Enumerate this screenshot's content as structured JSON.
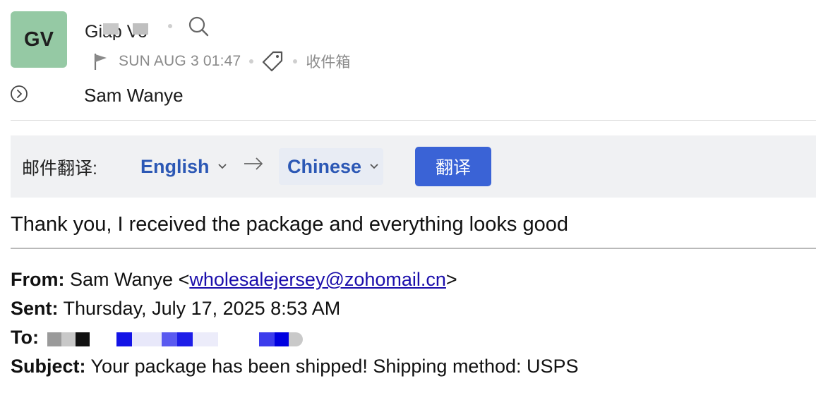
{
  "avatar": {
    "initials": "GV",
    "color": "#95c9a4"
  },
  "header": {
    "sender_name": "Giap Vo",
    "date": "SUN AUG 3 01:47",
    "folder": "收件箱",
    "recipient": "Sam Wanye",
    "icons": [
      "search-icon",
      "flag-icon",
      "tag-icon",
      "chevron-circle-icon"
    ]
  },
  "translate": {
    "label": "邮件翻译:",
    "source_lang": "English",
    "target_lang": "Chinese",
    "button_label": "翻译",
    "accent_color": "#3a63d6"
  },
  "message": {
    "body": "Thank you, I received the package and everything looks good"
  },
  "quoted": {
    "from_key": "From:",
    "from_name": "Sam Wanye <",
    "from_email": "wholesalejersey@zohomail.cn",
    "from_close": ">",
    "sent_key": "Sent:",
    "sent_value": "Thursday, July 17, 2025 8:53 AM",
    "to_key": "To:",
    "subject_key": "Subject:",
    "subject_value": "Your package has been shipped! Shipping method: USPS"
  }
}
